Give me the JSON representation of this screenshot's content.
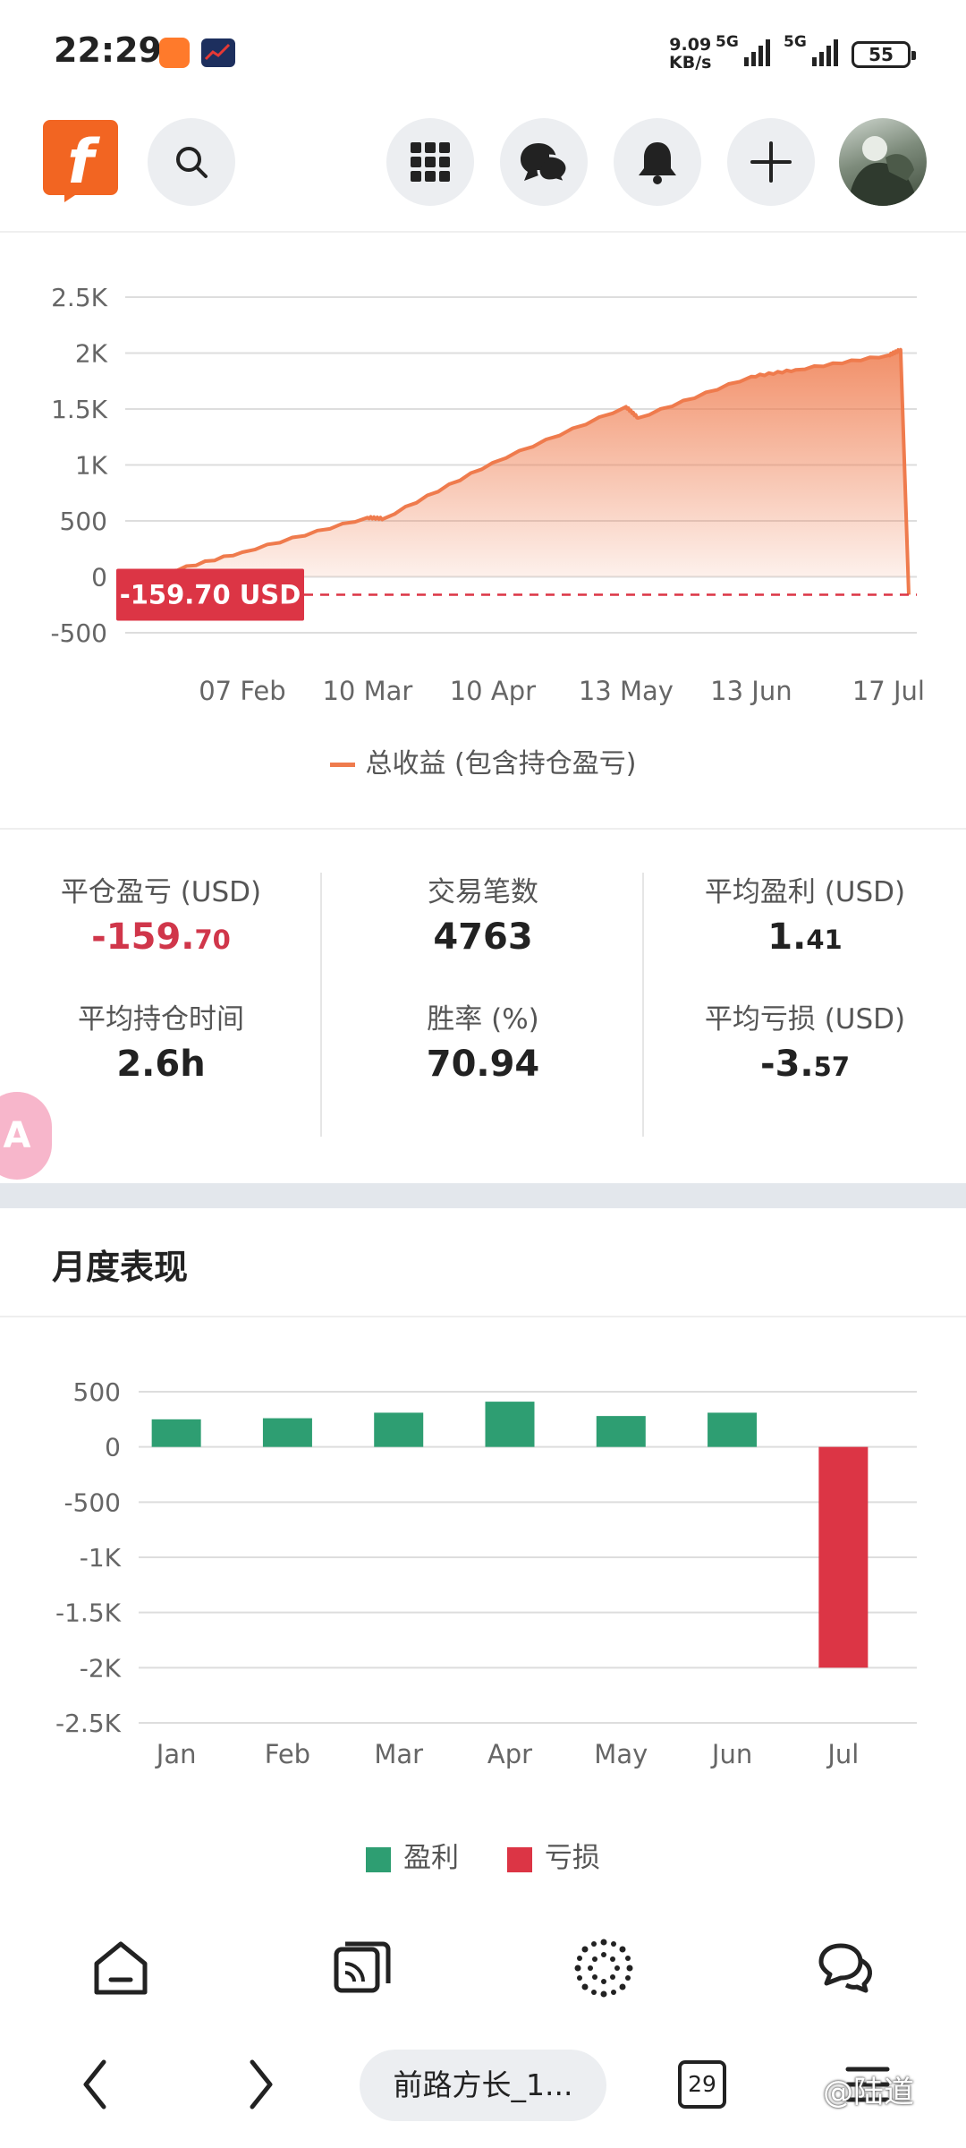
{
  "status_bar": {
    "time": "22:29",
    "net_speed_value": "9.09",
    "net_speed_unit": "KB/s",
    "signal_1": "5G",
    "signal_2": "5G",
    "battery": "55"
  },
  "header": {
    "logo_letter": "f",
    "icons": [
      "search-icon",
      "apps-grid-icon",
      "chat-icon",
      "bell-icon",
      "plus-icon"
    ],
    "brand_color": "#f26522"
  },
  "total_chart": {
    "label_value": "-159.70 USD",
    "legend": "总收益 (包含持仓盈亏)"
  },
  "stats": {
    "closed_pnl_label": "平仓盈亏 (USD)",
    "closed_pnl_int": "-159.",
    "closed_pnl_frac": "70",
    "trades_label": "交易笔数",
    "trades_value": "4763",
    "avg_profit_label": "平均盈利 (USD)",
    "avg_profit_int": "1.",
    "avg_profit_frac": "41",
    "avg_hold_label": "平均持仓时间",
    "avg_hold_value": "2.6h",
    "winrate_label": "胜率 (%)",
    "winrate_value": "70.94",
    "avg_loss_label": "平均亏损 (USD)",
    "avg_loss_int": "-3.",
    "avg_loss_frac": "57"
  },
  "fab_label": "A",
  "monthly": {
    "title": "月度表现",
    "legend_profit": "盈利",
    "legend_loss": "亏损"
  },
  "chart_data": [
    {
      "type": "area",
      "title": "",
      "series": [
        {
          "name": "总收益 (包含持仓盈亏)",
          "x": [
            "2023-01-15",
            "2023-02-07",
            "2023-03-10",
            "2023-03-14",
            "2023-04-10",
            "2023-05-13",
            "2023-05-16",
            "2023-06-13",
            "2023-06-24",
            "2023-07-17",
            "2023-07-20",
            "2023-07-22"
          ],
          "values": [
            0,
            220,
            530,
            520,
            1020,
            1520,
            1420,
            1790,
            1850,
            1980,
            2030,
            -159.7
          ]
        }
      ],
      "x_ticks": [
        "07 Feb",
        "10 Mar",
        "10 Apr",
        "13 May",
        "13 Jun",
        "17 Jul"
      ],
      "y_ticks": [
        "2.5K",
        "2K",
        "1.5K",
        "1K",
        "500",
        "0",
        "-500"
      ],
      "ylim": [
        -500,
        2500
      ],
      "grid": true,
      "annotation": "-159.70 USD",
      "colors": {
        "line": "#ef7b4d",
        "marker": "#dc3545"
      }
    },
    {
      "type": "bar",
      "title": "",
      "categories": [
        "Jan",
        "Feb",
        "Mar",
        "Apr",
        "May",
        "Jun",
        "Jul"
      ],
      "values": [
        250,
        260,
        310,
        410,
        280,
        310,
        -2000
      ],
      "y_ticks": [
        "500",
        "0",
        "-500",
        "-1K",
        "-1.5K",
        "-2K",
        "-2.5K"
      ],
      "ylim": [
        -2500,
        500
      ],
      "grid": true,
      "legend": [
        "盈利",
        "亏损"
      ],
      "colors": {
        "profit": "#2e9e72",
        "loss": "#dc3545"
      }
    }
  ],
  "bottom_nav": {
    "icons": [
      "home-icon",
      "feed-icon",
      "explore-icon",
      "messages-icon"
    ]
  },
  "browser_bar": {
    "address": "前路方长_1...",
    "tab_count": "29",
    "watermark": "@陆道"
  }
}
